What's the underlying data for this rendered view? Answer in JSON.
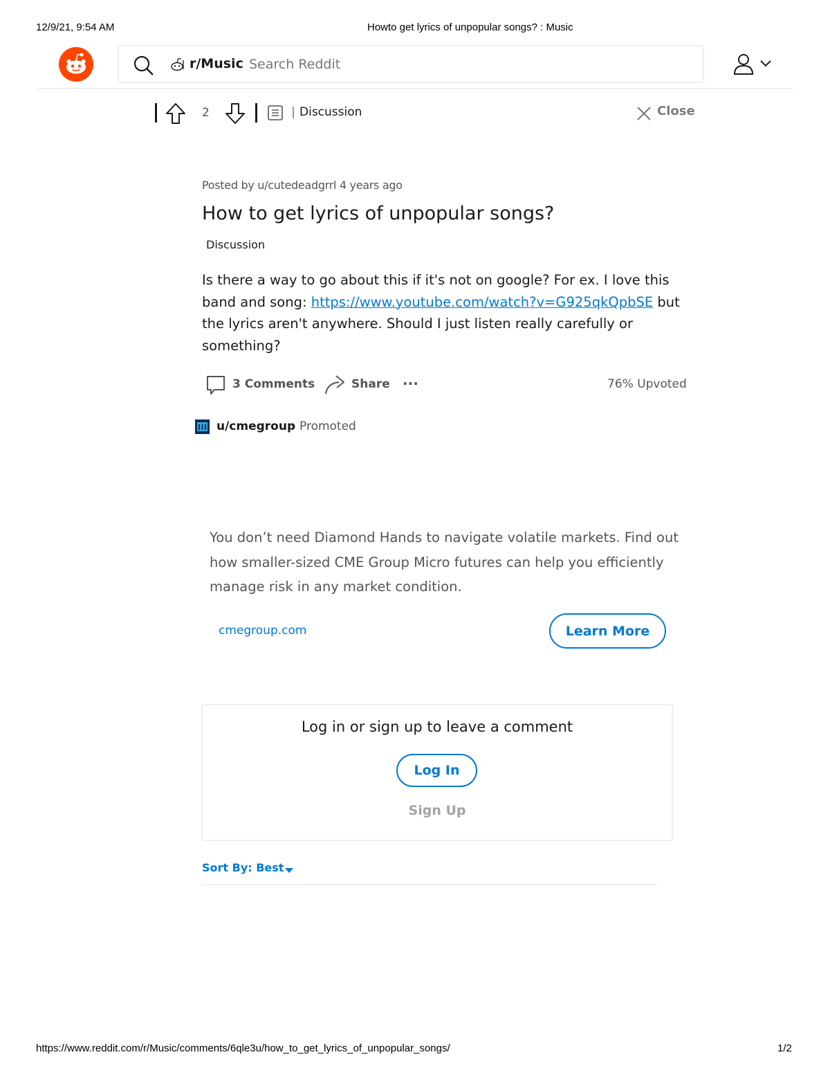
{
  "print": {
    "datetime": "12/9/21, 9:54 AM",
    "page_title": "Howto get lyrics of unpopular songs? : Music",
    "url": "https://www.reddit.com/r/Music/comments/6qle3u/how_to_get_lyrics_of_unpopular_songs/",
    "page_number": "1/2"
  },
  "header": {
    "logo_icon": "reddit-alien-icon",
    "search_icon": "search-icon",
    "subreddit_label": "r/Music",
    "search_placeholder": "Search Reddit",
    "user_icon": "user-icon",
    "chevron_icon": "chevron-down-icon",
    "brand_color": "#ff4500"
  },
  "toolbar": {
    "vote_count": "2",
    "flair_label": "Discussion",
    "close_label": "Close"
  },
  "post": {
    "meta": "Posted by u/cutedeadgrrl 4 years ago",
    "title": "How to get lyrics of unpopular songs?",
    "flair": "Discussion",
    "body_before_link": "Is there a way to go about this if it's not on google? For ex. I love this band and song: ",
    "link_text": "https://www.youtube.com/watch?v=G925qkQpbSE",
    "body_after_link": " but the lyrics aren't anywhere. Should I just listen really carefully or something?",
    "comments_label": "3 Comments",
    "share_label": "Share",
    "more_label": "···",
    "upvoted": "76% Upvoted",
    "link_color": "#0079d3"
  },
  "promoted": {
    "user": "u/cmegroup",
    "separator": "·",
    "tag": "Promoted",
    "text": "You don’t need Diamond Hands to navigate volatile markets. Find out how smaller-sized CME Group Micro futures can help you efficiently manage risk in any market condition.",
    "domain": "cmegroup.com",
    "cta": "Learn More"
  },
  "login": {
    "title": "Log in or sign up to leave a comment",
    "login_label": "Log In",
    "signup_label": "Sign Up"
  },
  "sort": {
    "label": "Sort By: Best"
  }
}
